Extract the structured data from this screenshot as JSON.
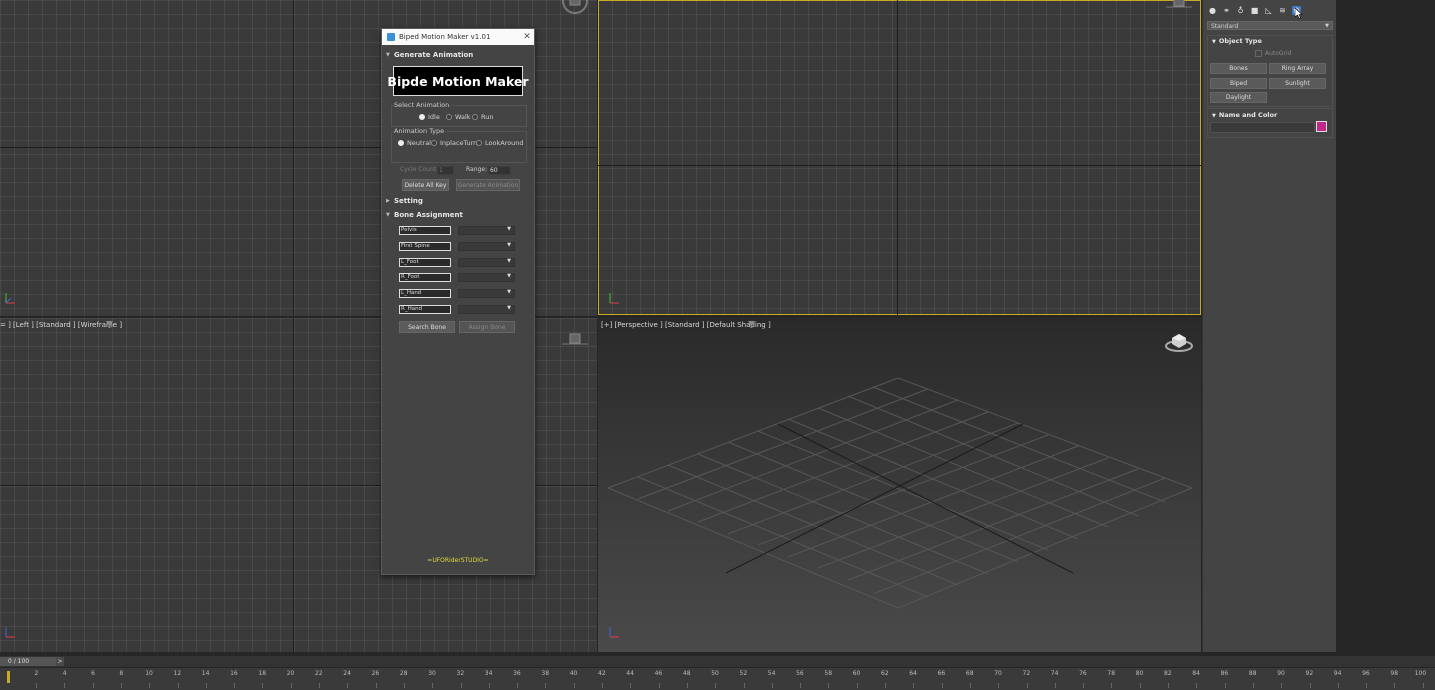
{
  "viewports": {
    "bottom_left_label": "= ] [Left ] [Standard ] [Wireframe ]",
    "bottom_right_label": "[+] [Perspective ] [Standard ] [Default Shading ]"
  },
  "dialog": {
    "title": "Biped Motion Maker v1.01",
    "close": "✕",
    "rollout_generate": "Generate Animation",
    "banner": "Bipde Motion Maker",
    "select_animation_label": "Select Animation",
    "anim_options": [
      "Idle",
      "Walk",
      "Run"
    ],
    "anim_selected": "Idle",
    "animation_type_label": "Animation Type",
    "type_options": [
      "Neutral",
      "InplaceTurn",
      "LookAround"
    ],
    "type_selected": "Neutral",
    "cycle_count_label": "Cycle Count:",
    "cycle_count_value": "1",
    "range_label": "Range:",
    "range_value": "60",
    "delete_all_key": "Delete All Key",
    "generate_animation": "Generate Animation",
    "rollout_setting": "Setting",
    "rollout_bone": "Bone Assignment",
    "bones": [
      "Pelvis",
      "First Spine",
      "L_Foot",
      "R_Foot",
      "L_Hand",
      "R_Hand"
    ],
    "search_bone": "Search Bone",
    "assign_bone": "Assign Bone",
    "footer": "=UFORiderSTUDIO="
  },
  "command_panel": {
    "category_dropdown": "Standard",
    "object_type_header": "Object Type",
    "autogrid": "AutoGrid",
    "buttons": [
      "Bones",
      "Ring Array",
      "Biped",
      "Sunlight",
      "Daylight"
    ],
    "name_color_header": "Name and Color",
    "name_value": "",
    "color_swatch": "#c0288a"
  },
  "timeline": {
    "frame_display": "0 / 100",
    "next_label": ">",
    "ticks": [
      "2",
      "4",
      "6",
      "8",
      "10",
      "12",
      "14",
      "16",
      "18",
      "20",
      "22",
      "24",
      "26",
      "28",
      "30",
      "32",
      "34",
      "36",
      "38",
      "40",
      "42",
      "44",
      "46",
      "48",
      "50",
      "52",
      "54",
      "56",
      "58",
      "60",
      "62",
      "64",
      "66",
      "68",
      "70",
      "72",
      "74",
      "76",
      "78",
      "80",
      "82",
      "84",
      "86",
      "88",
      "90",
      "92",
      "94",
      "96",
      "98",
      "100"
    ]
  }
}
